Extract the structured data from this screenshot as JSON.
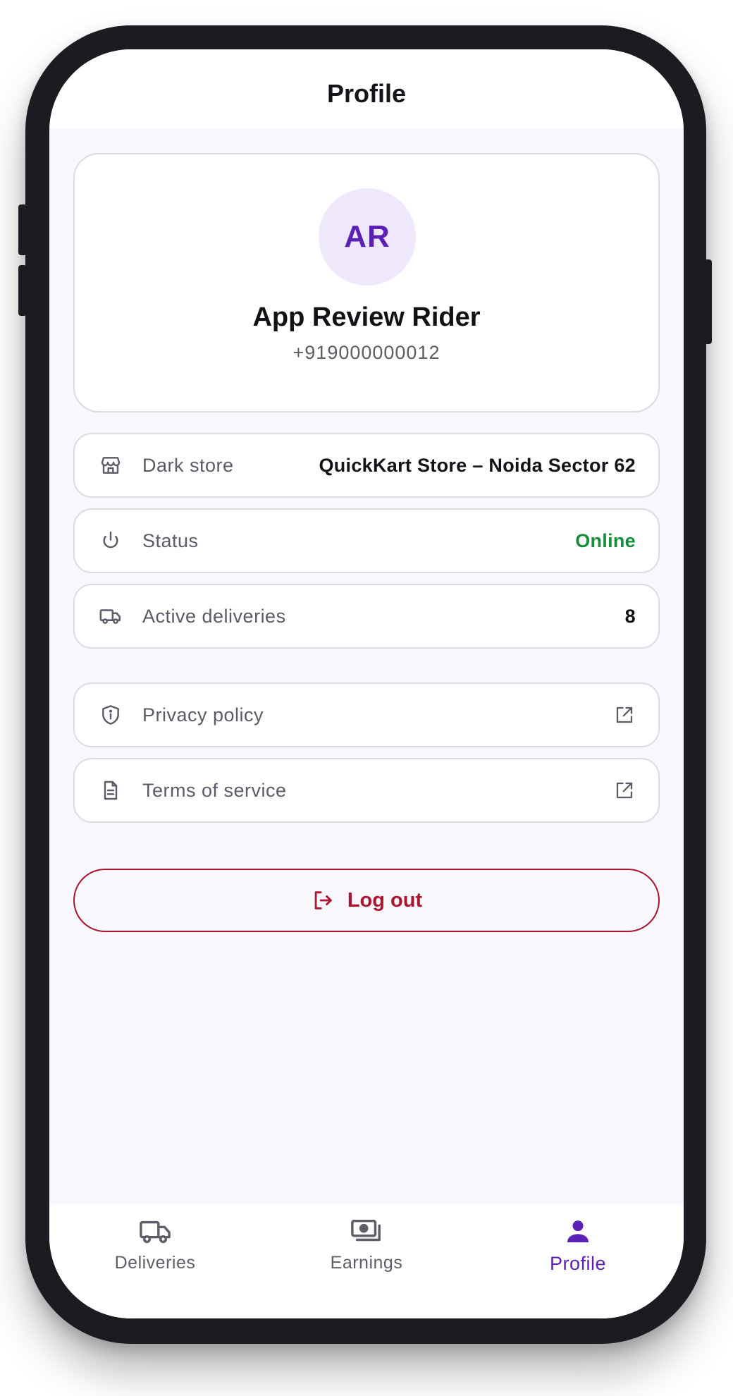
{
  "header": {
    "title": "Profile"
  },
  "profile": {
    "initials": "AR",
    "name": "App Review Rider",
    "phone": "+919000000012"
  },
  "info_rows": [
    {
      "icon": "store-icon",
      "label": "Dark store",
      "value": "QuickKart Store – Noida Sector 62"
    },
    {
      "icon": "power-icon",
      "label": "Status",
      "value": "Online",
      "value_color": "#198d3c"
    },
    {
      "icon": "truck-icon",
      "label": "Active deliveries",
      "value": "8"
    }
  ],
  "link_rows": [
    {
      "icon": "shield-info-icon",
      "label": "Privacy policy",
      "trailing_icon": "external-link-icon"
    },
    {
      "icon": "document-icon",
      "label": "Terms of service",
      "trailing_icon": "external-link-icon"
    }
  ],
  "logout": {
    "label": "Log out",
    "icon": "logout-icon",
    "color": "#a8162f"
  },
  "bottom_nav": {
    "active": "Profile",
    "items": [
      {
        "label": "Deliveries",
        "icon": "truck-icon"
      },
      {
        "label": "Earnings",
        "icon": "cash-icon"
      },
      {
        "label": "Profile",
        "icon": "user-icon"
      }
    ]
  },
  "colors": {
    "accent": "#5b21b6",
    "avatar_bg": "#efe8fc",
    "online": "#198d3c",
    "danger": "#a8162f",
    "background": "#f8f7fc"
  }
}
